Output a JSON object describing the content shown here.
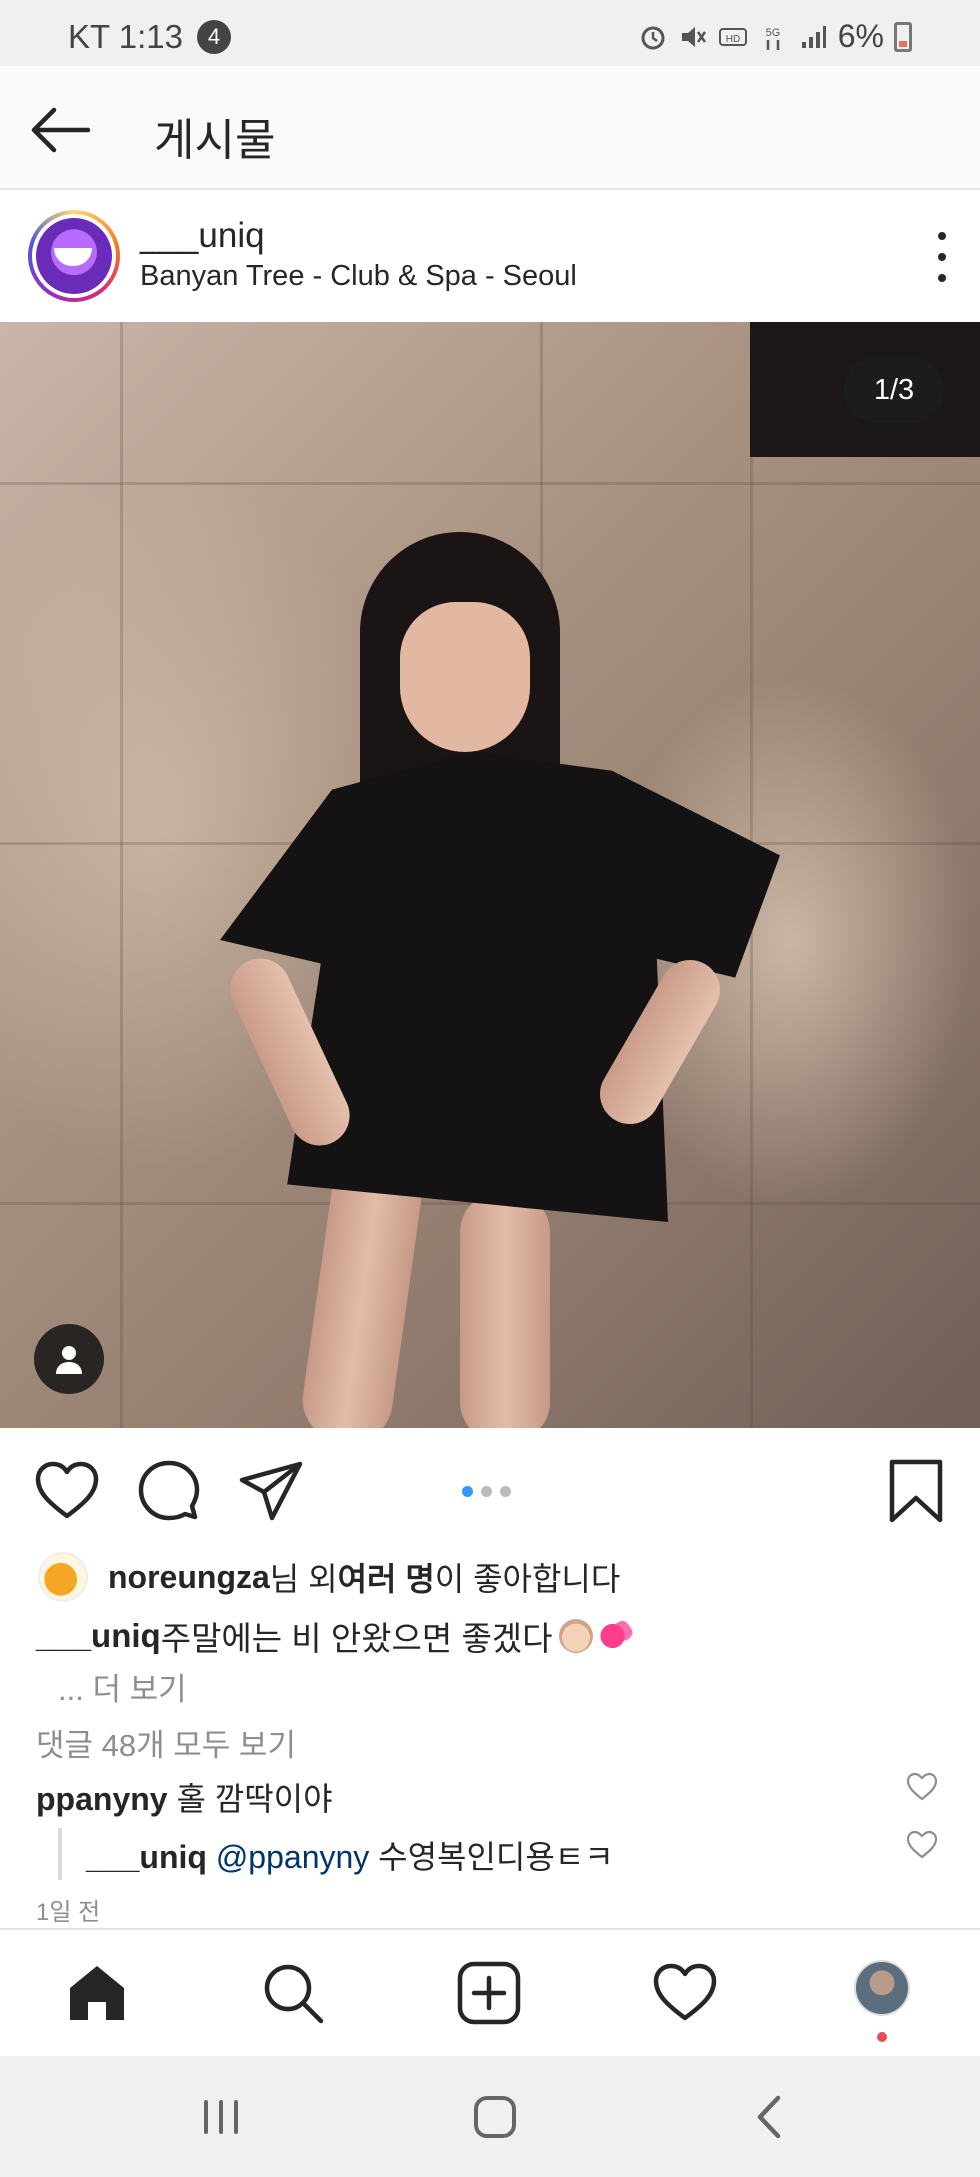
{
  "status_bar": {
    "carrier_time": "KT 1:13",
    "notification_count": "4",
    "battery_percent": "6%",
    "icons": [
      "alarm-icon",
      "mute-icon",
      "hd-icon",
      "5g-icon",
      "signal-icon",
      "battery-icon"
    ]
  },
  "header": {
    "title": "게시물",
    "back_icon": "arrow-left-icon"
  },
  "post": {
    "username": "___uniq",
    "location": "Banyan Tree - Club & Spa - Seoul",
    "image_counter": "1/3",
    "carousel_pages": 3,
    "carousel_active_index": 0
  },
  "likes": {
    "user": "noreungza",
    "mid_text": "님 외 ",
    "others": "여러 명",
    "suffix": "이 좋아합니다"
  },
  "caption": {
    "username": "___uniq",
    "text": " 주말에는 비 안왔으면 좋겠다",
    "more": "... 더 보기"
  },
  "comments": {
    "view_all": "댓글 48개 모두 보기",
    "items": [
      {
        "username": "ppanyny",
        "text": " 홀 깜딱이야"
      },
      {
        "username": "___uniq",
        "mention": "@ppanyny",
        "text": " 수영복인디용ㅌㅋ"
      }
    ]
  },
  "timestamp": "1일 전",
  "colors": {
    "accent": "#3897f0",
    "text": "#262626",
    "muted": "#8e8e8e",
    "notification": "#ed4956"
  }
}
